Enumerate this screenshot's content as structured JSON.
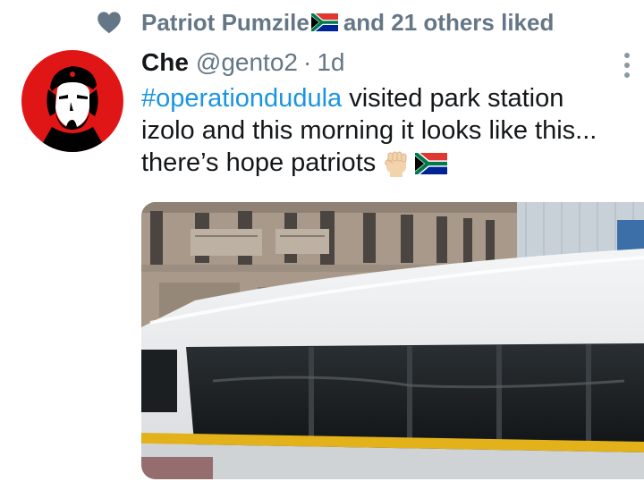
{
  "social_context": {
    "name": "Patriot Pumzile",
    "suffix": "and 21 others liked",
    "icon": "heart-icon"
  },
  "tweet": {
    "display_name": "Che",
    "handle": "@gento2",
    "separator": "·",
    "timestamp": "1d",
    "hashtag": "#operationdudula",
    "line1_rest": " visited park station",
    "line2": "izolo and this morning it looks like this...",
    "line3": "there’s hope patriots",
    "emojis": [
      "raised-fist-emoji",
      "south-africa-flag-emoji"
    ]
  },
  "colors": {
    "accent": "#1b95e0",
    "secondary_text": "#657786",
    "primary_text": "#14171a"
  }
}
